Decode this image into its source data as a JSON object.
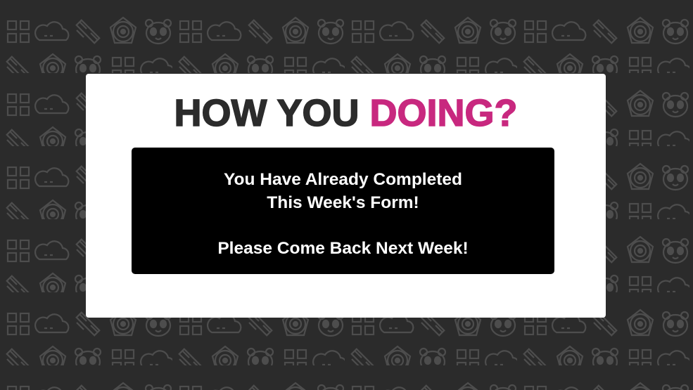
{
  "title": {
    "part1": "HOW YOU",
    "part2": "DOING?",
    "part1_color": "#2b2b2b",
    "part2_color": "#c8287f"
  },
  "message": {
    "line1": "You Have Already Completed",
    "line2": "This Week's Form!",
    "line3": "Please Come Back Next Week!"
  },
  "background": {
    "color": "#2b2b2b",
    "pattern_color": "#4a4a4a",
    "pattern_icons": [
      "grid-icon",
      "cloud-icon",
      "diagonal-bars-icon",
      "target-icon",
      "panda-icon"
    ]
  }
}
